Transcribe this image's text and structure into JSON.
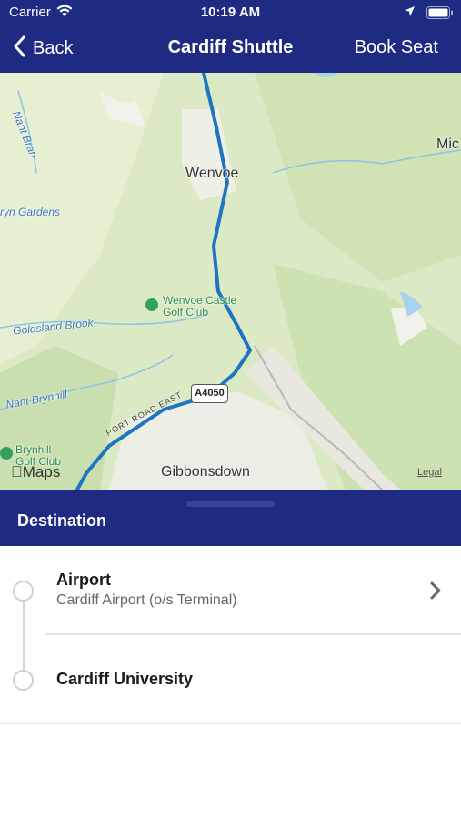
{
  "status_bar": {
    "carrier": "Carrier",
    "time": "10:19 AM",
    "icons": [
      "wifi-icon",
      "location-arrow-icon",
      "battery-icon"
    ]
  },
  "nav": {
    "back_label": "Back",
    "title": "Cardiff Shuttle",
    "book_label": "Book Seat"
  },
  "map": {
    "labels": {
      "nant_bran": "Nant Bran",
      "mic": "Mic",
      "wenvoe": "Wenvoe",
      "bryn_gardens": "ryn Gardens",
      "wenvoe_castle": "Wenvoe Castle",
      "golf_club": "Golf Club",
      "goldsland_brook": "Goldsland Brook",
      "nant_brynhill": "Nant Brynhill",
      "port_road": "PORT ROAD EAST",
      "brynhill": "Brynhill",
      "brynhill_golf": "Golf Club",
      "gibbonsdown": "Gibbonsdown"
    },
    "road_shield": "A4050",
    "attribution": "Maps",
    "legal": "Legal",
    "colors": {
      "land": "#d9e9c3",
      "route": "#1d75c2",
      "header": "#1f2b82"
    }
  },
  "sheet": {
    "title": "Destination"
  },
  "stops": [
    {
      "name": "Airport",
      "detail": "Cardiff Airport (o/s Terminal)"
    },
    {
      "name": "Cardiff University",
      "detail": ""
    }
  ]
}
